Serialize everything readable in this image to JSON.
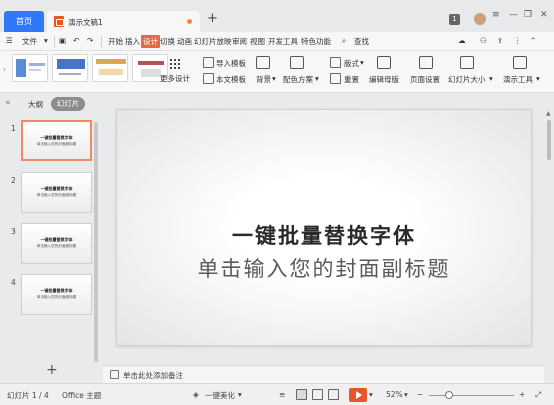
{
  "titlebar": {
    "home_tab": "首页",
    "doc_tab_title": "演示文稿1",
    "notification_count": "1"
  },
  "menu": {
    "file": "文件",
    "tabs": [
      "开始",
      "插入",
      "设计",
      "切换",
      "动画",
      "幻灯片放映",
      "审阅",
      "视图",
      "开发工具",
      "特色功能"
    ],
    "active_tab": "设计",
    "search": "查找"
  },
  "ribbon": {
    "more_designs": "更多设计",
    "import_template": "导入模板",
    "text_template": "本文模板",
    "background": "背景",
    "color_scheme": "配色方案",
    "layout": "版式",
    "reset": "重置",
    "edit_master": "编辑母版",
    "page_setup": "页面设置",
    "slide_size": "幻灯片大小",
    "presentation_tools": "演示工具"
  },
  "leftpanel": {
    "outline_label": "大纲",
    "slides_label": "幻灯片",
    "slides": [
      {
        "num": "1",
        "title": "一键批量替换字体",
        "subtitle": "单击输入您的封面副标题"
      },
      {
        "num": "2",
        "title": "一键批量替换字体",
        "subtitle": "单击输入您的封面副标题"
      },
      {
        "num": "3",
        "title": "一键批量替换字体",
        "subtitle": "单击输入您的封面副标题"
      },
      {
        "num": "4",
        "title": "一键批量替换字体",
        "subtitle": "单击输入您的封面副标题"
      }
    ]
  },
  "main_slide": {
    "title": "一键批量替换字体",
    "subtitle": "单击输入您的封面副标题"
  },
  "notes": {
    "placeholder": "单击此处添加备注"
  },
  "status": {
    "slide_indicator": "幻灯片 1 / 4",
    "theme": "Office 主题",
    "beautify": "一键美化",
    "zoom": "52%"
  },
  "colors": {
    "accent": "#e7552d",
    "home_tab": "#2f79f6",
    "selected_thumb_border": "#f08a66"
  }
}
